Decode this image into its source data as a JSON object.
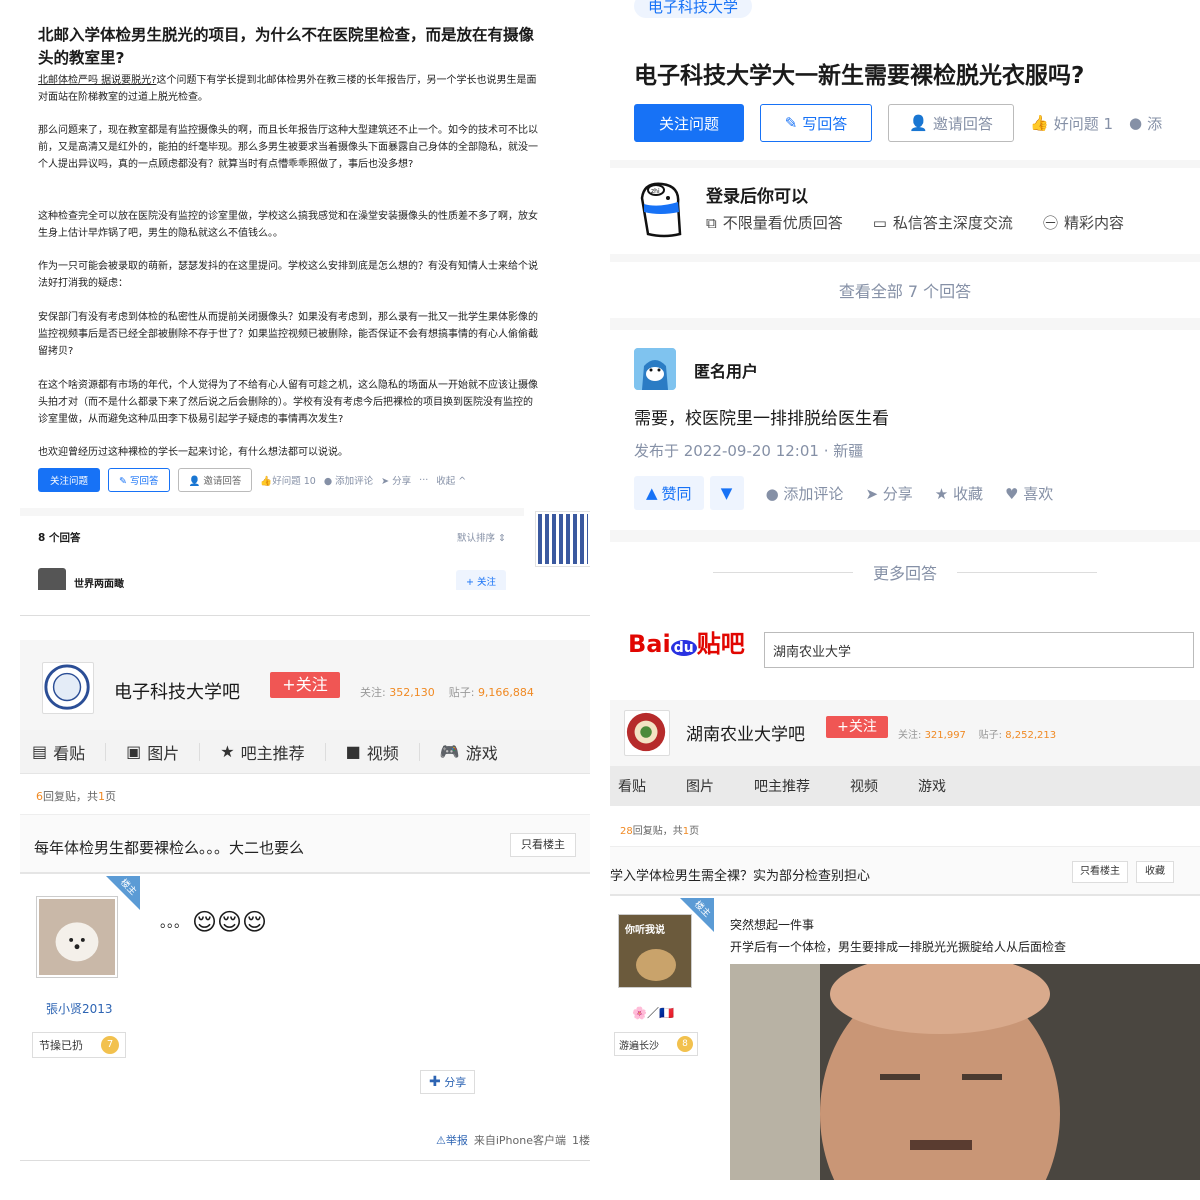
{
  "p1": {
    "title": "北邮入学体检男生脱光的项目，为什么不在医院里检查，而是放在有摄像头的教室里?",
    "link": "北邮体检严吗 据说要脱光?",
    "para1": "这个问题下有学长提到北邮体检男外在教三楼的长年报告厅，另一个学长也说男生是面对面站在阶梯教室的过道上脱光检查。",
    "para2": "那么问题来了，现在教室都是有监控摄像头的啊，而且长年报告厅这种大型建筑还不止一个。如今的技术可不比以前，又是高清又是红外的，能拍的纤毫毕现。那么多男生被要求当着摄像头下面暴露自己身体的全部隐私，就没一个人提出异议吗，真的一点顾虑都没有？就算当时有点懵乖乖照做了，事后也没多想?",
    "para3": "这种检查完全可以放在医院没有监控的诊室里做，学校这么搞我感觉和在澡堂安装摄像头的性质差不多了啊，放女生身上估计早炸锅了吧，男生的隐私就这么不值钱么。。",
    "para4": "作为一只可能会被录取的萌新，瑟瑟发抖的在这里提问。学校这么安排到底是怎么想的？有没有知情人士来给个说法好打消我的疑虑：",
    "para5": "安保部门有没有考虑到体检的私密性从而提前关闭摄像头？如果没有考虑到，那么录有一批又一批学生果体影像的监控视频事后是否已经全部被删除不存于世了？如果监控视频已被删除，能否保证不会有想搞事情的有心人偷偷截留拷贝?",
    "para6": "在这个啥资源都有市场的年代，个人觉得为了不给有心人留有可趁之机，这么隐私的场面从一开始就不应该让摄像头拍才对（而不是什么都录下来了然后说之后会删除的）。学校有没有考虑今后把裸检的项目换到医院没有监控的诊室里做，从而避免这种瓜田李下极易引起学子疑虑的事情再次发生?",
    "para7": "也欢迎曾经历过这种裸检的学长一起来讨论，有什么想法都可以说说。",
    "btn_follow": "关注问题",
    "btn_write": "写回答",
    "btn_invite": "邀请回答",
    "good": "好问题 10",
    "comment": "添加评论",
    "share": "分享",
    "more": "···",
    "collapse": "收起",
    "ans_count": "8 个回答",
    "sort": "默认排序",
    "user": "世界两面瞰",
    "follow_user": "+ 关注"
  },
  "p2": {
    "tag": "电子科技大学",
    "title": "电子科技大学大一新生需要裸检脱光衣服吗?",
    "btn_follow": "关注问题",
    "btn_write": "写回答",
    "btn_invite": "邀请回答",
    "good": "好问题 1",
    "comment": "添",
    "login_title": "登录后你可以",
    "feat1": "不限量看优质回答",
    "feat2": "私信答主深度交流",
    "feat3": "精彩内容",
    "see_all": "查看全部 7 个回答",
    "anon": "匿名用户",
    "answer": "需要，校医院里一排排脱给医生看",
    "date": "发布于 2022-09-20 12:01 · 新疆",
    "vote": "赞同",
    "add_comment": "添加评论",
    "share": "分享",
    "fav": "收藏",
    "like": "喜欢",
    "more": "更多回答"
  },
  "p3": {
    "bar_name": "电子科技大学吧",
    "follow": "+关注",
    "fans_label": "关注:",
    "fans": "352,130",
    "posts_label": "贴子:",
    "posts": "9,166,884",
    "nav": [
      "看贴",
      "图片",
      "吧主推荐",
      "视频",
      "游戏"
    ],
    "replies": "6",
    "crumb_mid": "回复贴，共",
    "pages": "1",
    "crumb_end": "页",
    "post_title": "每年体检男生都要裸检么。。。大二也要么",
    "only_op": "只看楼主",
    "corner": "楼主",
    "user": "張小贤2013",
    "badge": "节操已扔",
    "level": "7",
    "content": "。。。",
    "share": "分享",
    "report": "举报",
    "client": "来自iPhone客户端",
    "floor": "1楼"
  },
  "p4": {
    "logo": "Bai贴吧",
    "search": "湖南农业大学",
    "bar_name": "湖南农业大学吧",
    "follow": "+关注",
    "fans_label": "关注:",
    "fans": "321,997",
    "posts_label": "贴子:",
    "posts": "8,252,213",
    "nav": [
      "看贴",
      "图片",
      "吧主推荐",
      "视频",
      "游戏"
    ],
    "replies": "28",
    "crumb_mid": "回复贴，共",
    "pages": "1",
    "crumb_end": "页",
    "post_title": "学入学体检男生需全裸？实为部分检查别担心",
    "only_op": "只看楼主",
    "fav": "收藏",
    "corner": "楼主",
    "avatar_text": "你听我说",
    "badge": "游遍长沙",
    "level": "8",
    "line1": "突然想起一件事",
    "line2": "开学后有一个体检，男生要排成一排脱光光撅腚给人从后面检查"
  }
}
